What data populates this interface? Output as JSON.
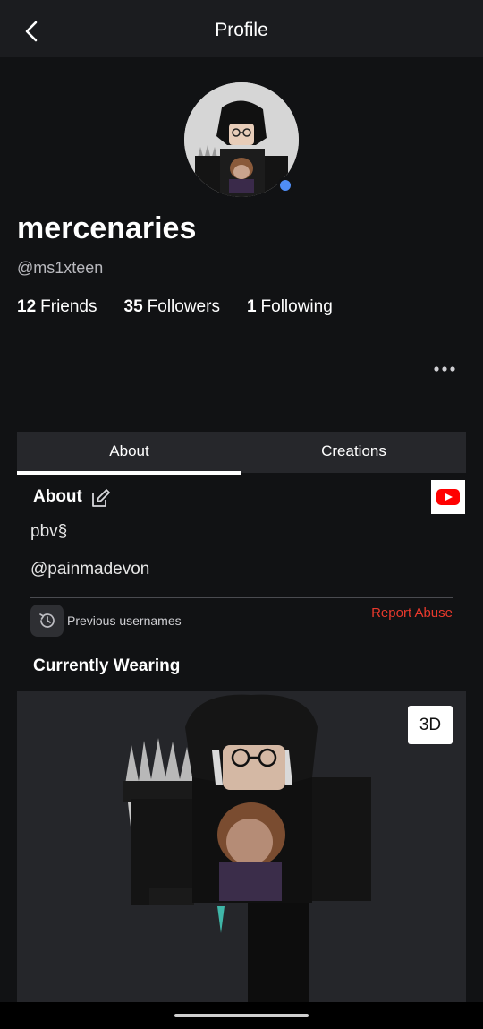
{
  "header": {
    "title": "Profile",
    "back_icon": "chevron-left-icon"
  },
  "profile": {
    "display_name": "mercenaries",
    "username": "@ms1xteen",
    "presence_color": "#4f8df5",
    "stats": [
      {
        "count": "12",
        "label": "Friends"
      },
      {
        "count": "35",
        "label": "Followers"
      },
      {
        "count": "1",
        "label": "Following"
      }
    ]
  },
  "tabs": [
    {
      "label": "About",
      "active": true
    },
    {
      "label": "Creations",
      "active": false
    }
  ],
  "about": {
    "title": "About",
    "bio_lines": [
      "pbv§",
      "@painmadevon"
    ],
    "previous_usernames_label": "Previous usernames",
    "report_label": "Report Abuse",
    "report_color": "#e8392c",
    "social_icon": "youtube-icon"
  },
  "wearing": {
    "title": "Currently Wearing",
    "view_3d_label": "3D"
  }
}
